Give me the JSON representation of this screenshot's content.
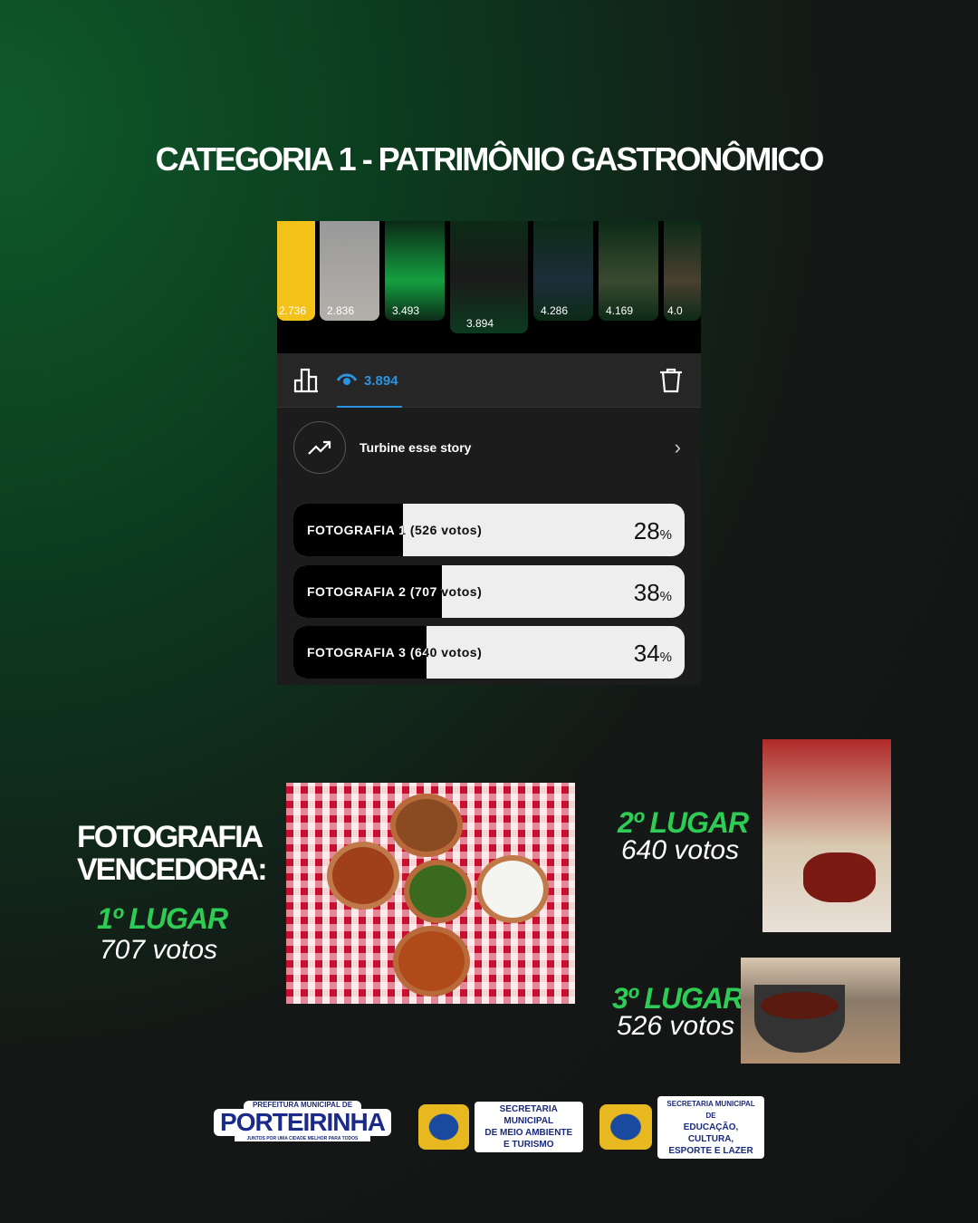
{
  "title": "CATEGORIA 1 - PATRIMÔNIO GASTRONÔMICO",
  "stories": [
    {
      "views": "2.736"
    },
    {
      "views": "2.836"
    },
    {
      "views": "3.493"
    },
    {
      "views": "3.894",
      "selected": true
    },
    {
      "views": "4.286"
    },
    {
      "views": "4.169"
    },
    {
      "views": "4.0"
    }
  ],
  "stats": {
    "views": "3.894",
    "icons": [
      "bar-chart-icon",
      "eye-icon",
      "trash-icon"
    ]
  },
  "promote": {
    "label": "Turbine esse story"
  },
  "poll": [
    {
      "label": "FOTOGRAFIA 1 (526 votos)",
      "percent": 28,
      "pct_text": "28"
    },
    {
      "label": "FOTOGRAFIA 2 (707 votos)",
      "percent": 38,
      "pct_text": "38"
    },
    {
      "label": "FOTOGRAFIA 3 (640 votos)",
      "percent": 34,
      "pct_text": "34"
    }
  ],
  "percent_sign": "%",
  "winner": {
    "heading_line1": "FOTOGRAFIA",
    "heading_line2": "VENCEDORA:",
    "place": "1º LUGAR",
    "votes": "707 votos"
  },
  "second": {
    "place": "2º LUGAR",
    "votes": "640 votos"
  },
  "third": {
    "place": "3º LUGAR",
    "votes": "526 votos"
  },
  "logos": [
    {
      "top": "PREFEITURA MUNICIPAL DE",
      "name": "PORTEIRINHA",
      "slogan": "JUNTOS POR UMA CIDADE MELHOR PARA TODOS"
    },
    {
      "line1": "SECRETARIA MUNICIPAL",
      "line2": "DE MEIO AMBIENTE",
      "line3": "E TURISMO"
    },
    {
      "line1": "SECRETARIA MUNICIPAL DE",
      "line2": "EDUCAÇÃO, CULTURA,",
      "line3": "ESPORTE E LAZER"
    }
  ],
  "colors": {
    "accent_green": "#2fcc55",
    "views_blue": "#2a93e0",
    "panel": "#1c1c1c"
  }
}
